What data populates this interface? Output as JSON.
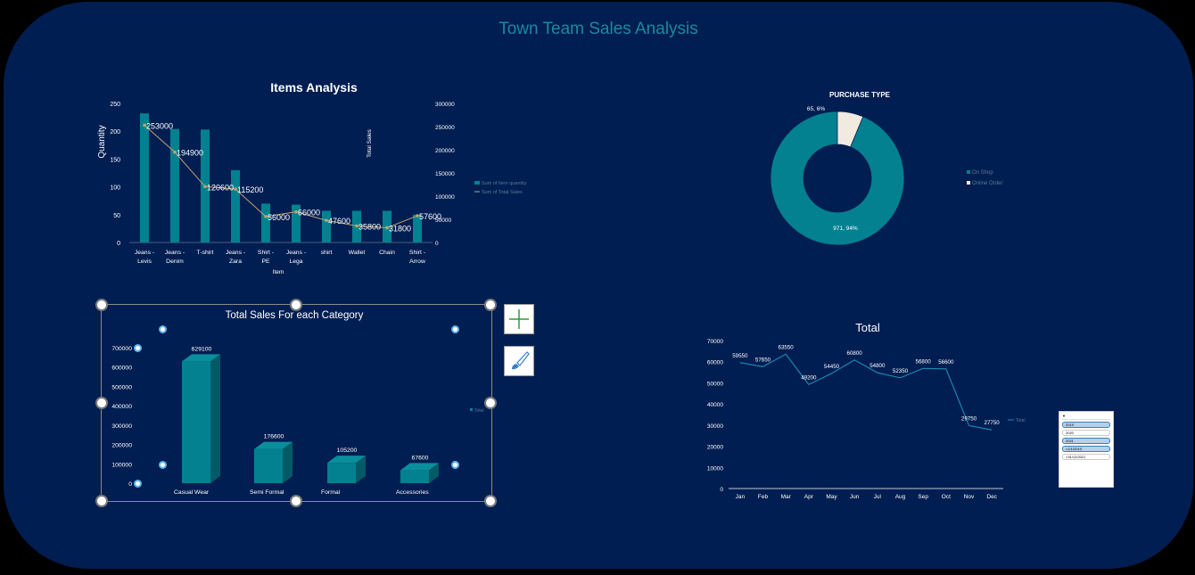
{
  "dashboard": {
    "title": "Town Team Sales Analysis"
  },
  "colors": {
    "background": "#011E52",
    "teal": "#038190",
    "cream": "#F1EADF",
    "line": "#C4A070"
  },
  "chart_data": [
    {
      "id": "items",
      "type": "bar",
      "title": "Items Analysis",
      "xlabel": "Item",
      "ylabel": "Quantity",
      "y2label": "Total Sales",
      "categories": [
        "Jeans - Levis",
        "Jeans - Denim",
        "T-shirt",
        "Jeans - Zara",
        "Shirt - PE",
        "Jeans - Lega",
        "shirt",
        "Wallet",
        "Chain",
        "Shirt - Arrow"
      ],
      "series": [
        {
          "name": "Sum of Item quantity",
          "type": "bar",
          "axis": "left",
          "values": [
            232,
            204,
            203,
            130,
            70,
            68,
            57,
            57,
            57,
            50
          ]
        },
        {
          "name": "Sum of Total Sales",
          "type": "line",
          "axis": "right",
          "values": [
            253000,
            194900,
            120600,
            115200,
            56000,
            66000,
            47600,
            35800,
            31800,
            57600
          ]
        }
      ],
      "yticks": [
        "0",
        "50",
        "100",
        "150",
        "200",
        "250"
      ],
      "y2ticks": [
        "0",
        "50000",
        "100000",
        "150000",
        "200000",
        "250000",
        "300000"
      ],
      "ylim": [
        0,
        250
      ],
      "y2lim": [
        0,
        300000
      ],
      "legend": "right"
    },
    {
      "id": "purchase",
      "type": "pie",
      "title": "PURCHASE TYPE",
      "labels": [
        "On Shop",
        "Online Order"
      ],
      "values": [
        971,
        65
      ],
      "data_labels": [
        "971, 94%",
        "65, 6%"
      ],
      "legend": "right"
    },
    {
      "id": "category",
      "type": "bar",
      "title": "Total Sales For each Category",
      "categories": [
        "Casual Wear",
        "Semi Formal",
        "Formal",
        "Accessories"
      ],
      "series": [
        {
          "name": "Total",
          "values": [
            629100,
            176600,
            105200,
            67600
          ]
        }
      ],
      "yticks": [
        "0",
        "100000",
        "200000",
        "300000",
        "400000",
        "500000",
        "600000",
        "700000"
      ],
      "ylim": [
        0,
        700000
      ],
      "legend": "right"
    },
    {
      "id": "monthly",
      "type": "line",
      "title": "Total",
      "categories": [
        "Jan",
        "Feb",
        "Mar",
        "Apr",
        "May",
        "Jun",
        "Jul",
        "Aug",
        "Sep",
        "Oct",
        "Nov",
        "Dec"
      ],
      "series": [
        {
          "name": "Total",
          "values": [
            59550,
            57650,
            63550,
            49200,
            54450,
            60800,
            54800,
            52350,
            56800,
            56600,
            29750,
            27750
          ]
        }
      ],
      "yticks": [
        "0",
        "10000",
        "20000",
        "30000",
        "40000",
        "50000",
        "60000",
        "70000"
      ],
      "ylim": [
        0,
        70000
      ],
      "legend": "right"
    }
  ],
  "slicer": {
    "items": [
      "2019",
      "2020",
      "2021",
      "<1/1/2019",
      ">31/12/2021"
    ]
  },
  "tools": {
    "add_icon": "plus-icon",
    "style_icon": "brush-icon"
  }
}
